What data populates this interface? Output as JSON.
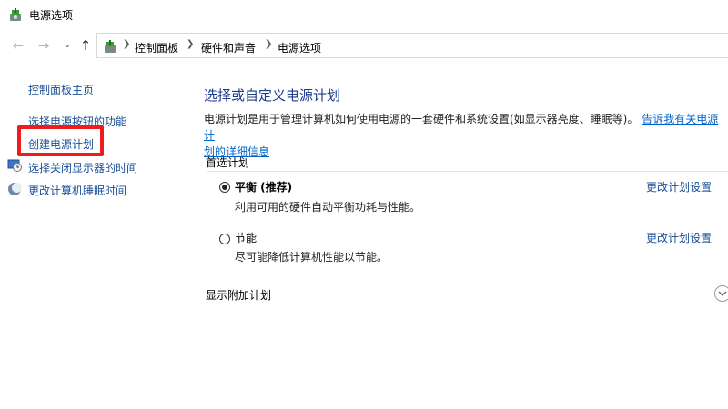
{
  "window": {
    "title": "电源选项",
    "title_icon": "power-options-icon"
  },
  "navigation": {
    "back_icon": "arrow-left-icon",
    "forward_icon": "arrow-right-icon",
    "up_icon": "arrow-up-icon",
    "breadcrumb": [
      "控制面板",
      "硬件和声音",
      "电源选项"
    ]
  },
  "sidebar": {
    "home_link": "控制面板主页",
    "items": [
      {
        "label": "选择电源按钮的功能"
      },
      {
        "label": "创建电源计划",
        "highlighted": true
      },
      {
        "label": "选择关闭显示器的时间",
        "icon": "monitor-clock-icon"
      },
      {
        "label": "更改计算机睡眠时间",
        "icon": "moon-icon"
      }
    ],
    "highlight_color": "#ee1c1c"
  },
  "main": {
    "title": "选择或自定义电源计划",
    "description": "电源计划是用于管理计算机如何使用电源的一套硬件和系统设置(如显示器亮度、睡眠等)。",
    "description_link_part1": "告诉我有关电源计",
    "description_link_part2": "划的详细信息",
    "preferred_label": "首选计划",
    "plans": [
      {
        "name": "平衡 (推荐)",
        "description": "利用可用的硬件自动平衡功耗与性能。",
        "change_link": "更改计划设置",
        "selected": true
      },
      {
        "name": "节能",
        "description": "尽可能降低计算机性能以节能。",
        "change_link": "更改计划设置",
        "selected": false
      }
    ],
    "show_more_label": "显示附加计划",
    "expand_icon": "chevron-down-icon"
  },
  "colors": {
    "title_blue": "#1e3c8c",
    "link_blue": "#1a4f97",
    "hyperlink": "#0066cc"
  }
}
